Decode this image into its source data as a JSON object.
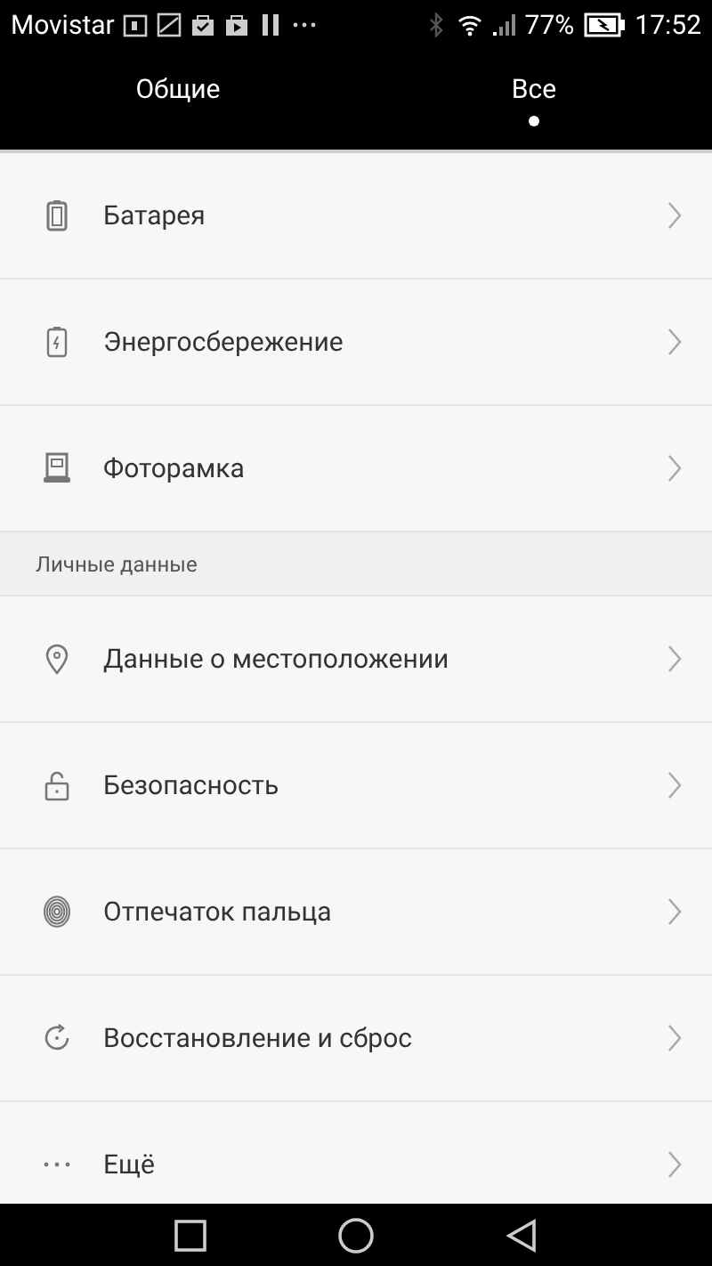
{
  "status_bar": {
    "carrier": "Movistar",
    "battery": "77%",
    "time": "17:52"
  },
  "tabs": [
    {
      "label": "Общие",
      "selected": false
    },
    {
      "label": "Все",
      "selected": true
    }
  ],
  "sections": [
    {
      "items": [
        {
          "label": "Батарея",
          "kind": "battery"
        },
        {
          "label": "Энергосбережение",
          "kind": "power"
        },
        {
          "label": "Фоторамка",
          "kind": "frame"
        }
      ]
    },
    {
      "header": "Личные данные",
      "items": [
        {
          "label": "Данные о местоположении",
          "kind": "location"
        },
        {
          "label": "Безопасность",
          "kind": "lock"
        },
        {
          "label": "Отпечаток пальца",
          "kind": "fingerprint"
        },
        {
          "label": "Восстановление и сброс",
          "kind": "restore"
        },
        {
          "label": "Ещё",
          "kind": "more"
        }
      ]
    }
  ]
}
